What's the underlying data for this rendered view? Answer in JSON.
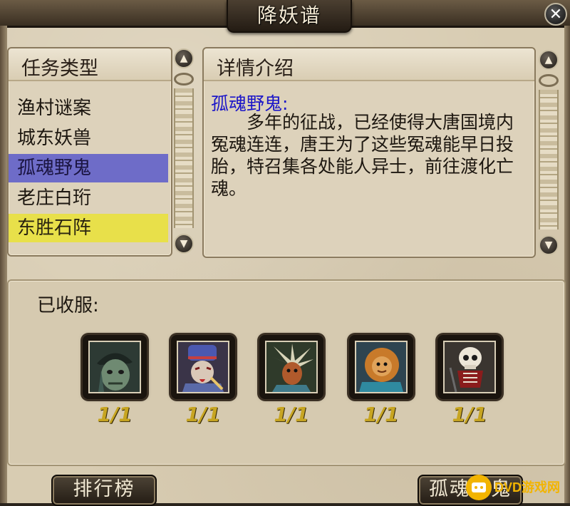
{
  "window": {
    "title": "降妖谱",
    "close_glyph": "✕"
  },
  "categories_panel": {
    "header": "任务类型",
    "items": [
      {
        "label": "渔村谜案",
        "state": "normal"
      },
      {
        "label": "城东妖兽",
        "state": "normal"
      },
      {
        "label": "孤魂野鬼",
        "state": "selected"
      },
      {
        "label": "老庄白珩",
        "state": "normal"
      },
      {
        "label": "东胜石阵",
        "state": "highlight"
      }
    ]
  },
  "detail_panel": {
    "header": "详情介绍",
    "title": "孤魂野鬼:",
    "text": "多年的征战，已经使得大唐国境内冤魂连连，唐王为了这些冤魂能早日投胎，特召集各处能人异士，前往渡化亡魂。"
  },
  "caught": {
    "label": "已收服:",
    "slots": [
      {
        "icon": "ghost-zombie-portrait-icon",
        "count": "1/1"
      },
      {
        "icon": "ghost-official-portrait-icon",
        "count": "1/1"
      },
      {
        "icon": "feathered-demon-portrait-icon",
        "count": "1/1"
      },
      {
        "icon": "lion-beast-portrait-icon",
        "count": "1/1"
      },
      {
        "icon": "skeleton-ghost-portrait-icon",
        "count": "1/1"
      }
    ]
  },
  "buttons": {
    "ranking": "排行榜",
    "current": "孤魂野鬼"
  },
  "watermark": {
    "text": "DVD游戏网"
  },
  "colors": {
    "selected": "#6e6cc8",
    "highlight": "#e8e04a",
    "detail_title": "#1c16c8",
    "count": "#c7a522"
  }
}
